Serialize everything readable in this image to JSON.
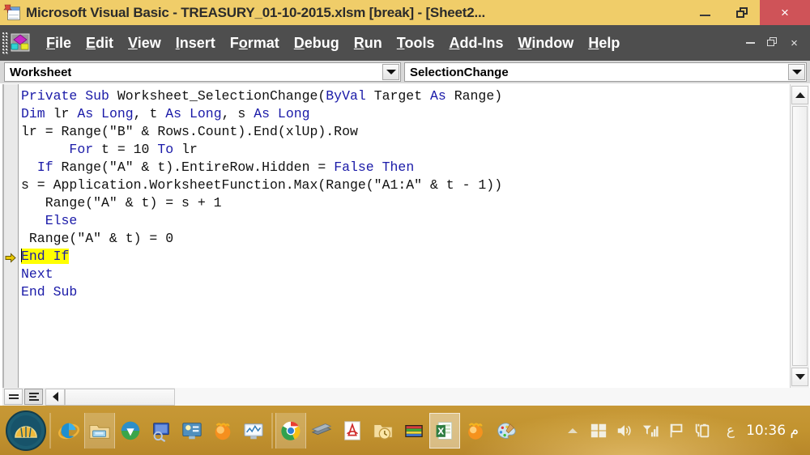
{
  "window": {
    "title": "Microsoft Visual Basic - TREASURY_01-10-2015.xlsm [break] - [Sheet2...",
    "icon": "excel-vba-sheet-icon",
    "minimize_label": "–",
    "restore_label": "❐",
    "close_label": "×"
  },
  "menubar": {
    "app_icon": "visual-basic-icon",
    "items": [
      {
        "label": "File",
        "accel": "F"
      },
      {
        "label": "Edit",
        "accel": "E"
      },
      {
        "label": "View",
        "accel": "V"
      },
      {
        "label": "Insert",
        "accel": "I"
      },
      {
        "label": "Format",
        "accel": "o"
      },
      {
        "label": "Debug",
        "accel": "D"
      },
      {
        "label": "Run",
        "accel": "R"
      },
      {
        "label": "Tools",
        "accel": "T"
      },
      {
        "label": "Add-Ins",
        "accel": "A"
      },
      {
        "label": "Window",
        "accel": "W"
      },
      {
        "label": "Help",
        "accel": "H"
      }
    ],
    "mdi_minimize": "–",
    "mdi_restore": "❐",
    "mdi_close": "×"
  },
  "combos": {
    "object": {
      "value": "Worksheet",
      "caret": "chevron-down-icon"
    },
    "procedure": {
      "value": "SelectionChange",
      "caret": "chevron-down-icon"
    }
  },
  "code": {
    "highlight_color": "#ffff00",
    "keyword_color": "#1a1aa8",
    "text_color": "#111111",
    "lines": [
      {
        "indent": 0,
        "highlighted": false,
        "exec_marker": false,
        "tokens": [
          {
            "t": "Private",
            "kw": true
          },
          {
            "t": " "
          },
          {
            "t": "Sub",
            "kw": true
          },
          {
            "t": " Worksheet_SelectionChange("
          },
          {
            "t": "ByVal",
            "kw": true
          },
          {
            "t": " Target "
          },
          {
            "t": "As",
            "kw": true
          },
          {
            "t": " Range)"
          }
        ]
      },
      {
        "indent": 0,
        "highlighted": false,
        "exec_marker": false,
        "tokens": [
          {
            "t": "Dim",
            "kw": true
          },
          {
            "t": " lr "
          },
          {
            "t": "As",
            "kw": true
          },
          {
            "t": " "
          },
          {
            "t": "Long",
            "kw": true
          },
          {
            "t": ", t "
          },
          {
            "t": "As",
            "kw": true
          },
          {
            "t": " "
          },
          {
            "t": "Long",
            "kw": true
          },
          {
            "t": ", s "
          },
          {
            "t": "As",
            "kw": true
          },
          {
            "t": " "
          },
          {
            "t": "Long",
            "kw": true
          }
        ]
      },
      {
        "indent": 0,
        "highlighted": false,
        "exec_marker": false,
        "tokens": [
          {
            "t": "lr = Range(\"B\" & Rows.Count).End(xlUp).Row"
          }
        ]
      },
      {
        "indent": 6,
        "highlighted": false,
        "exec_marker": false,
        "tokens": [
          {
            "t": "For",
            "kw": true
          },
          {
            "t": " t = 10 "
          },
          {
            "t": "To",
            "kw": true
          },
          {
            "t": " lr"
          }
        ]
      },
      {
        "indent": 2,
        "highlighted": false,
        "exec_marker": false,
        "tokens": [
          {
            "t": "If",
            "kw": true
          },
          {
            "t": " Range(\"A\" & t).EntireRow.Hidden = "
          },
          {
            "t": "False",
            "kw": true
          },
          {
            "t": " "
          },
          {
            "t": "Then",
            "kw": true
          }
        ]
      },
      {
        "indent": 0,
        "highlighted": false,
        "exec_marker": false,
        "tokens": [
          {
            "t": "s = Application.WorksheetFunction.Max(Range(\"A1:A\" & t - 1))"
          }
        ]
      },
      {
        "indent": 3,
        "highlighted": false,
        "exec_marker": false,
        "tokens": [
          {
            "t": "Range(\"A\" & t) = s + 1"
          }
        ]
      },
      {
        "indent": 3,
        "highlighted": false,
        "exec_marker": false,
        "tokens": [
          {
            "t": "Else",
            "kw": true
          }
        ]
      },
      {
        "indent": 1,
        "highlighted": false,
        "exec_marker": false,
        "tokens": [
          {
            "t": "Range(\"A\" & t) = 0"
          }
        ]
      },
      {
        "indent": 0,
        "highlighted": true,
        "exec_marker": true,
        "tokens": [
          {
            "t": "End",
            "kw": true
          },
          {
            "t": " "
          },
          {
            "t": "If",
            "kw": true
          }
        ]
      },
      {
        "indent": 0,
        "highlighted": false,
        "exec_marker": false,
        "tokens": [
          {
            "t": "Next",
            "kw": true
          }
        ]
      },
      {
        "indent": 0,
        "highlighted": false,
        "exec_marker": false,
        "tokens": [
          {
            "t": "End",
            "kw": true
          },
          {
            "t": " "
          },
          {
            "t": "Sub",
            "kw": true
          }
        ]
      }
    ]
  },
  "scrollbars": {
    "vertical": {
      "up": "scroll-up-arrow-icon",
      "down": "scroll-down-arrow-icon"
    },
    "horizontal": {
      "left": "scroll-left-arrow-icon"
    }
  },
  "view_buttons": {
    "procedure_view": "procedure-view-icon",
    "full_module_view": "full-module-view-icon"
  },
  "taskbar": {
    "start": "classic-shell-start-orb",
    "pinned": [
      {
        "name": "internet-explorer-icon"
      },
      {
        "name": "file-explorer-icon",
        "framed": true
      },
      {
        "name": "internet-download-manager-icon"
      },
      {
        "name": "remote-desktop-icon"
      },
      {
        "name": "system-info-icon"
      },
      {
        "name": "orange-sunburst-icon"
      },
      {
        "name": "monitor-chart-icon"
      },
      {
        "name": "google-chrome-icon"
      },
      {
        "name": "scanner-icon"
      },
      {
        "name": "adobe-acrobat-icon"
      },
      {
        "name": "folder-clock-icon"
      },
      {
        "name": "winrar-icon"
      },
      {
        "name": "microsoft-excel-icon",
        "active": true
      },
      {
        "name": "orange-flame-icon"
      },
      {
        "name": "paint-palette-icon"
      }
    ],
    "tray": {
      "overflow": "show-hidden-icons-chevron",
      "windows_flag": "windows-flag-icon",
      "volume": "speaker-volume-icon",
      "network": "network-signal-icon",
      "action_center": "action-center-flag-icon",
      "battery": "battery-charging-icon",
      "language": "ع",
      "time": "10:36 م"
    }
  }
}
